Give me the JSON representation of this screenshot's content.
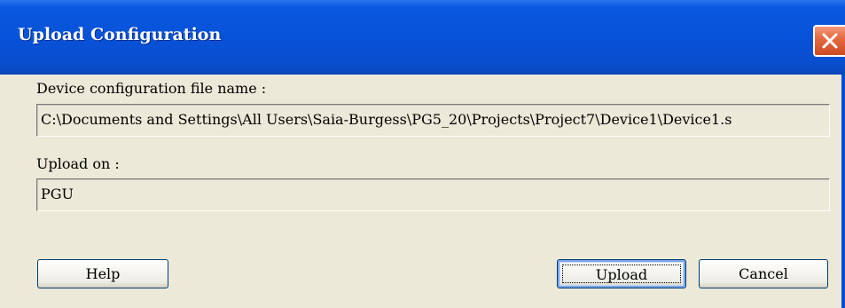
{
  "dialog": {
    "title": "Upload Configuration"
  },
  "fields": {
    "config_file_label": "Device configuration file name :",
    "config_file_value": "C:\\Documents and Settings\\All Users\\Saia-Burgess\\PG5_20\\Projects\\Project7\\Device1\\Device1.s",
    "upload_on_label": "Upload on :",
    "upload_on_value": "PGU"
  },
  "buttons": {
    "help": "Help",
    "upload": "Upload",
    "cancel": "Cancel"
  },
  "colors": {
    "title_bar": "#0752d8",
    "close_button": "#e56a44",
    "dialog_background": "#ece9d8"
  },
  "icons": {
    "close": "close-icon"
  }
}
